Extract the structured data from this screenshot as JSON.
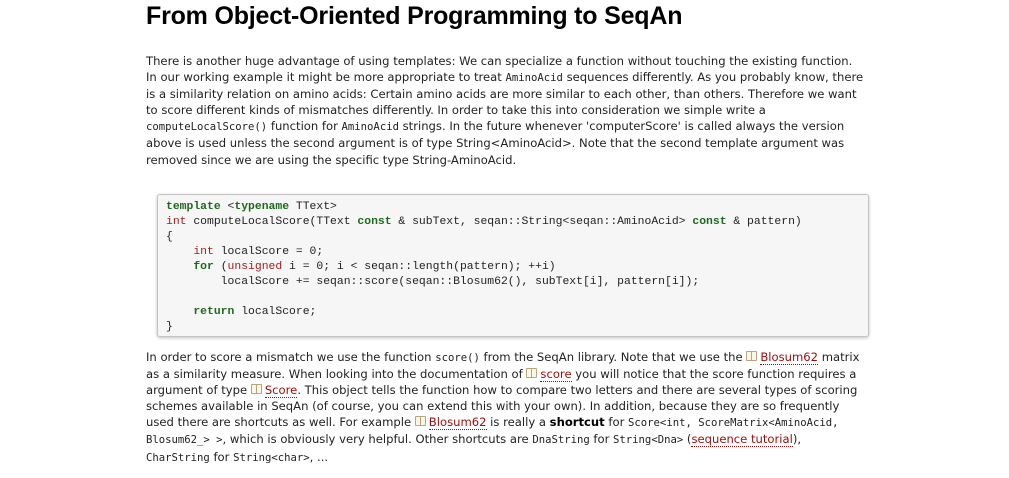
{
  "page": {
    "title": "From Object-Oriented Programming to SeqAn"
  },
  "para1": {
    "t1": "There is another huge advantage of using templates: We can specialize a function without touching the existing function. In our working example it might be more appropriate to treat ",
    "c1": "AminoAcid",
    "t2": " sequences differently. As you probably know, there is a similarity relation on amino acids: Certain amino acids are more similar to each other, than others. Therefore we want to score different kinds of mismatches differently. In order to take this into consideration we simple write a ",
    "c2": "computeLocalScore()",
    "t3": " function for ",
    "c3": "AminoAcid",
    "t4": " strings. In the future whenever 'computerScore' is called always the version above is used unless the second argument is of type String<AminoAcid>. Note that the second template argument was removed since we are using the specific type String-AminoAcid."
  },
  "code": {
    "l1_kw1": "template",
    "l1_a": " <",
    "l1_kw2": "typename",
    "l1_b": " TText>",
    "l2_ty": "int",
    "l2_a": " computeLocalScore(TText ",
    "l2_kw1": "const",
    "l2_b": " & subText, seqan::String<seqan::AminoAcid> ",
    "l2_kw2": "const",
    "l2_c": " & pattern)",
    "l3": "{",
    "l4_ind": "    ",
    "l4_ty": "int",
    "l4_a": " localScore = 0;",
    "l5_ind": "    ",
    "l5_kw": "for",
    "l5_a": " (",
    "l5_ty": "unsigned",
    "l5_b": " i = 0; i < seqan::length(pattern); ++i)",
    "l6": "        localScore += seqan::score(seqan::Blosum62(), subText[i], pattern[i]);",
    "l7": "",
    "l8_ind": "    ",
    "l8_kw": "return",
    "l8_a": " localScore;",
    "l9": "}"
  },
  "para2": {
    "t1": "In order to score a mismatch we use the function ",
    "c1": "score()",
    "t2": " from the SeqAn library. Note that we use the ",
    "link1": "Blosum62",
    "t3": " matrix as a similarity measure. When looking into the documentation of ",
    "link2": "score",
    "t4": " you will notice that the score function requires a argument of type ",
    "link3": "Score",
    "t5": ". This object tells the function how to compare two letters and there are several types of scoring schemes available in SeqAn (of course, you can extend this with your own). In addition, because they are so frequently used there are shortcuts as well. For example ",
    "link4": "Blosum62",
    "t6": " is really a ",
    "strong": "shortcut",
    "t7": " for ",
    "c2": "Score<int, ScoreMatrix<AminoAcid, Blosum62_> >",
    "t8": ", which is obviously very helpful. Other shortcuts are ",
    "c3": "DnaString",
    "t9": " for ",
    "c4": "String<Dna>",
    "t10": " (",
    "link5": "sequence tutorial",
    "t11": "), ",
    "c5": "CharString",
    "t12": " for ",
    "c6": "String<char>",
    "t13": ", ..."
  }
}
